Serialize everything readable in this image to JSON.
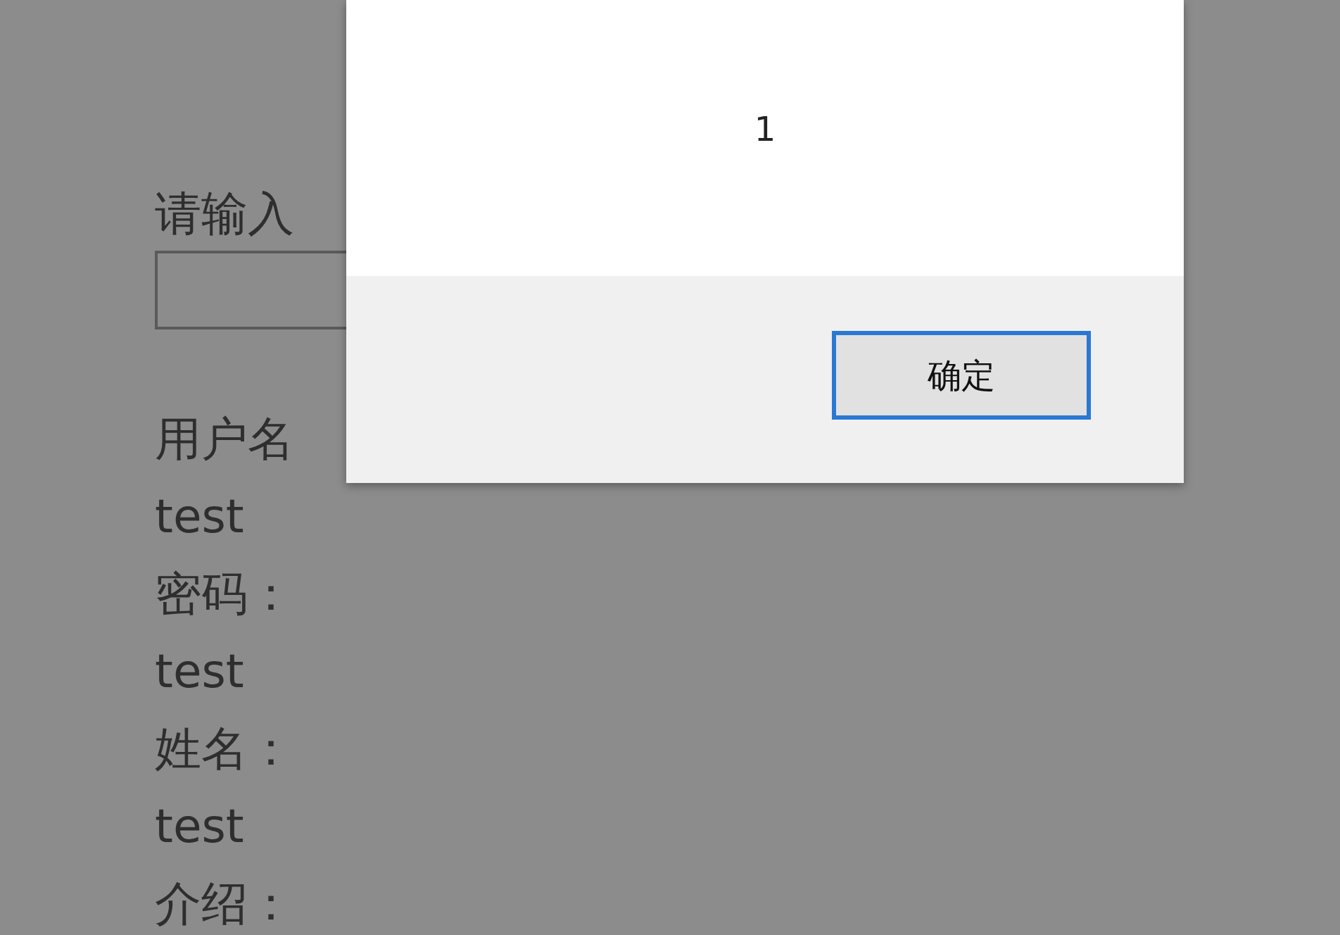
{
  "page": {
    "prompt_label": "请输入",
    "lines": [
      "用户名",
      "test",
      "密码：",
      "test",
      "姓名：",
      "test",
      "介绍："
    ]
  },
  "dialog": {
    "message": "1",
    "buttons": [
      {
        "label": "确定",
        "selected": true
      }
    ]
  }
}
